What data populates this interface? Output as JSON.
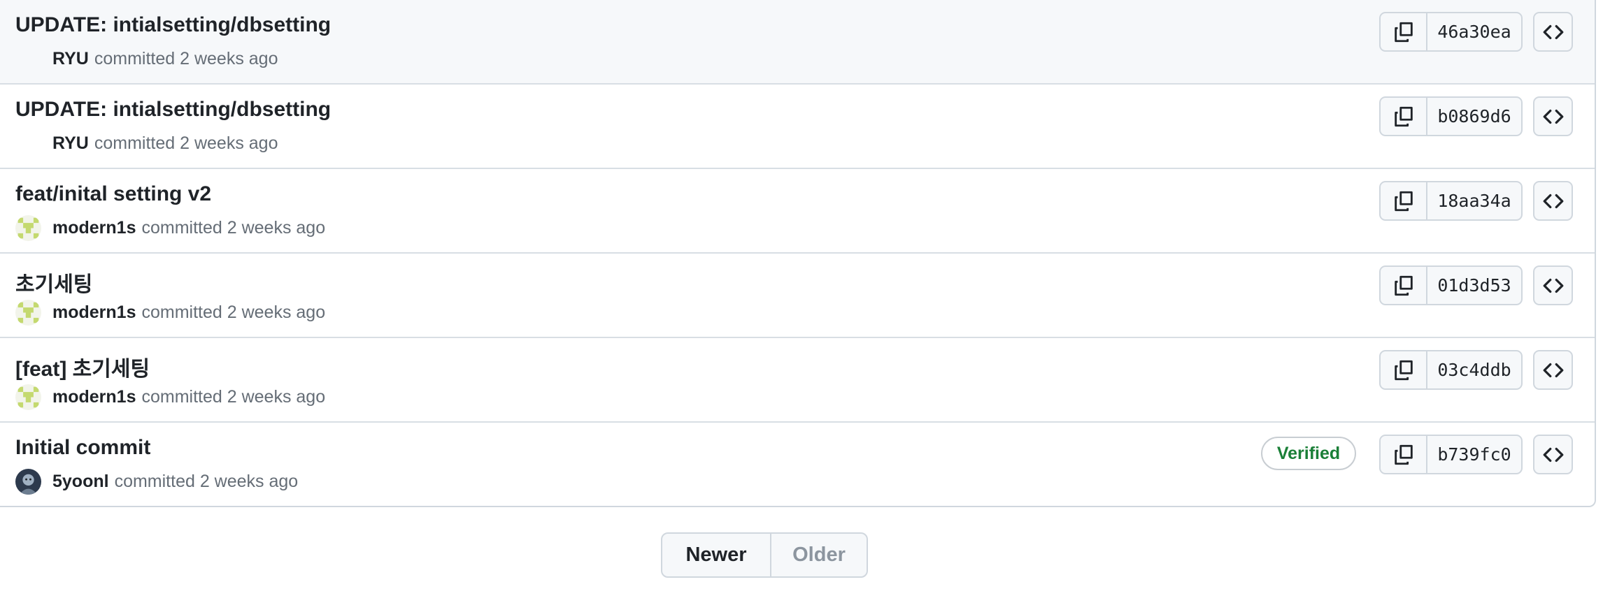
{
  "commits": [
    {
      "title": "UPDATE: intialsetting/dbsetting",
      "author": "RYU",
      "action": "committed 2 weeks ago",
      "sha": "46a30ea",
      "avatar": "none",
      "verified": false
    },
    {
      "title": "UPDATE: intialsetting/dbsetting",
      "author": "RYU",
      "action": "committed 2 weeks ago",
      "sha": "b0869d6",
      "avatar": "none",
      "verified": false
    },
    {
      "title": "feat/inital setting v2",
      "author": "modern1s",
      "action": "committed 2 weeks ago",
      "sha": "18aa34a",
      "avatar": "identicon",
      "verified": false
    },
    {
      "title": "초기세팅",
      "author": "modern1s",
      "action": "committed 2 weeks ago",
      "sha": "01d3d53",
      "avatar": "identicon",
      "verified": false
    },
    {
      "title": "[feat] 초기세팅",
      "author": "modern1s",
      "action": "committed 2 weeks ago",
      "sha": "03c4ddb",
      "avatar": "identicon",
      "verified": false
    },
    {
      "title": "Initial commit",
      "author": "5yoonl",
      "action": "committed 2 weeks ago",
      "sha": "b739fc0",
      "avatar": "photo",
      "verified": true,
      "badge": "Verified"
    }
  ],
  "icons": {
    "copy": "copy-icon",
    "browse": "code-icon"
  },
  "pagination": {
    "newer": "Newer",
    "older": "Older"
  },
  "colors": {
    "verified": "#1a7f37",
    "identicon": "#c4d96f",
    "border": "#d0d7de",
    "highlight_row": "#f6f8fa"
  }
}
